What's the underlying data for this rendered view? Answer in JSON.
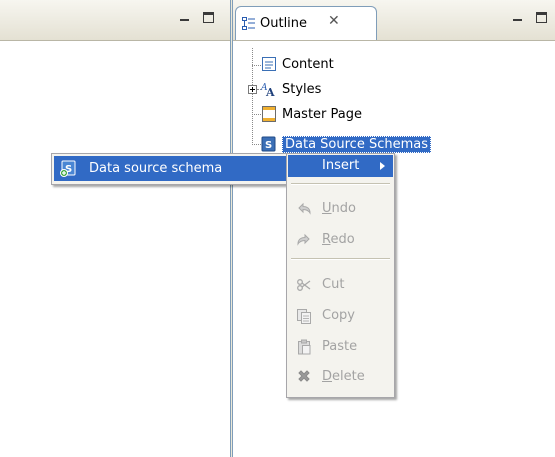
{
  "outline": {
    "tab_label": "Outline",
    "close_glyph": "✕",
    "tree": [
      {
        "label": "Content",
        "icon": "content-icon"
      },
      {
        "label": "Styles",
        "icon": "styles-icon",
        "expander": "+"
      },
      {
        "label": "Master Page",
        "icon": "master-page-icon"
      },
      {
        "label": "Data Source Schemas",
        "icon": "data-source-schemas-icon",
        "selected": true
      }
    ]
  },
  "context_menu": {
    "items": [
      {
        "label": "Insert",
        "icon": "",
        "active": true
      },
      {
        "label": "Undo",
        "icon": "undo-icon",
        "disabled": true
      },
      {
        "label": "Redo",
        "icon": "redo-icon",
        "disabled": true
      },
      {
        "label": "Cut",
        "icon": "scissors-icon",
        "disabled": true
      },
      {
        "label": "Copy",
        "icon": "copy-icon",
        "disabled": true
      },
      {
        "label": "Paste",
        "icon": "paste-icon",
        "disabled": true
      },
      {
        "label": "Delete",
        "icon": "delete-icon",
        "disabled": true
      }
    ]
  },
  "submenu": {
    "item_label": "Data source schema",
    "icon": "data-source-schema-icon"
  },
  "colors": {
    "selection": "#316ac5",
    "menu_bg": "#f4f3ee",
    "disabled_text": "#a3a3a3"
  }
}
